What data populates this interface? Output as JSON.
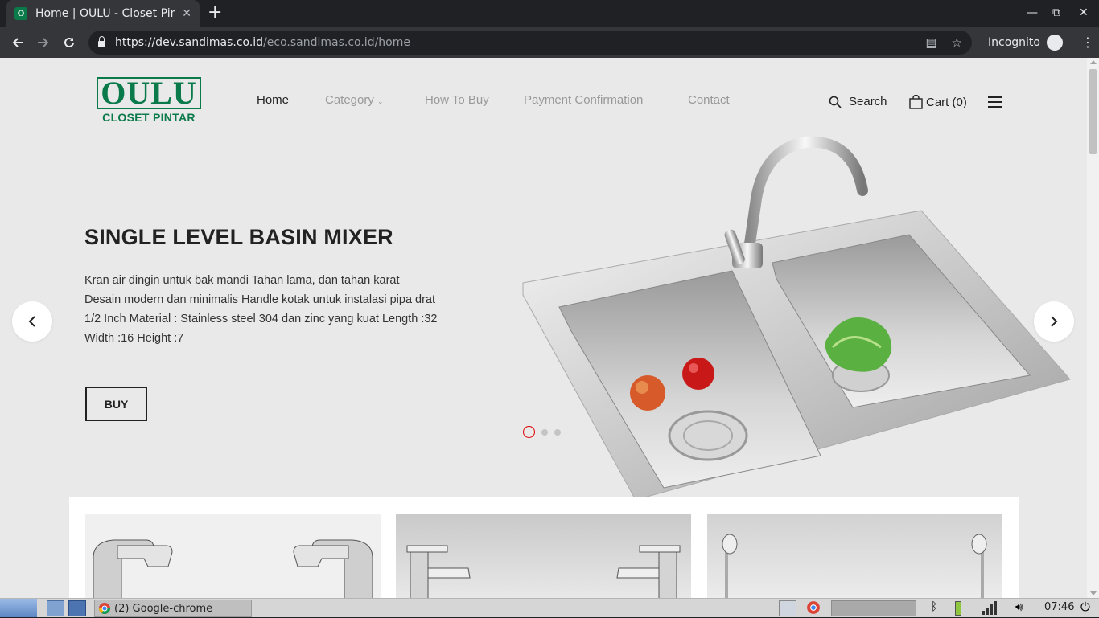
{
  "browser": {
    "tab_title": "Home | OULU - Closet Pintar",
    "tab_favicon_letter": "O",
    "new_tab_symbol": "+",
    "url_host": "https://dev.sandimas.co.id",
    "url_path": "/eco.sandimas.co.id/home",
    "incognito_label": "Incognito"
  },
  "site": {
    "logo_main": "OULU",
    "logo_sub": "CLOSET PINTAR",
    "brand_color": "#0b7a4b",
    "nav": {
      "home": "Home",
      "category": "Category",
      "how_to_buy": "How To Buy",
      "payment_confirmation": "Payment Confirmation",
      "contact": "Contact"
    },
    "search_label": "Search",
    "cart_label": "Cart (0)"
  },
  "hero": {
    "title": "SINGLE LEVEL BASIN MIXER",
    "description": "Kran air dingin untuk bak mandi Tahan lama, dan tahan karat Desain modern dan minimalis Handle kotak untuk instalasi pipa drat 1/2 Inch Material : Stainless steel 304 dan zinc yang kuat Length :32 Width :16 Height :7",
    "buy_label": "BUY",
    "slide_count": 3,
    "active_slide": 1,
    "active_dot_color": "#dd0000"
  },
  "taskbar": {
    "window_label": "(2) Google-chrome",
    "clock": "07:46"
  }
}
